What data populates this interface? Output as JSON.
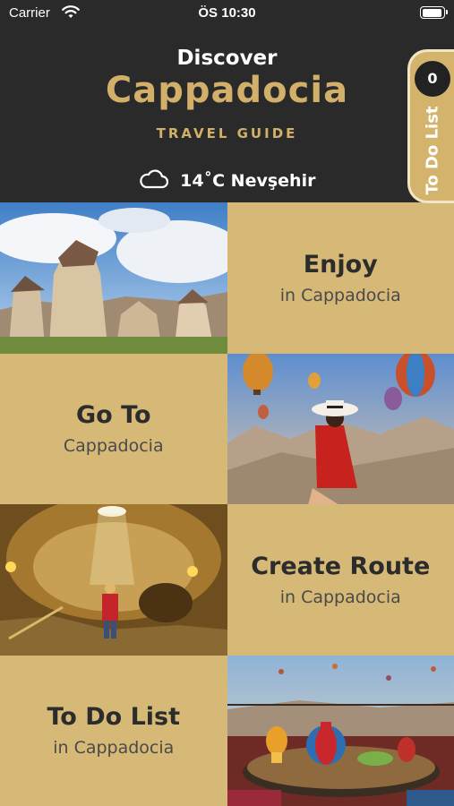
{
  "status_bar": {
    "carrier": "Carrier",
    "time": "ÖS 10:30"
  },
  "header": {
    "discover": "Discover",
    "name": "Cappadocia",
    "subtitle": "TRAVEL GUIDE",
    "weather": "14˚C Nevşehir"
  },
  "todo_tab": {
    "count": "0",
    "label": "To Do List"
  },
  "menu": [
    {
      "title": "Enjoy",
      "subtitle": "in Cappadocia"
    },
    {
      "title": "Go To",
      "subtitle": "Cappadocia"
    },
    {
      "title": "Create Route",
      "subtitle": "in Cappadocia"
    },
    {
      "title": "To Do List",
      "subtitle": "in Cappadocia"
    }
  ],
  "colors": {
    "gold": "#d6b877",
    "dark": "#2a2a2a",
    "brand_text": "#d2b06a"
  },
  "icons": [
    "wifi-icon",
    "battery-icon",
    "cloud-icon"
  ]
}
